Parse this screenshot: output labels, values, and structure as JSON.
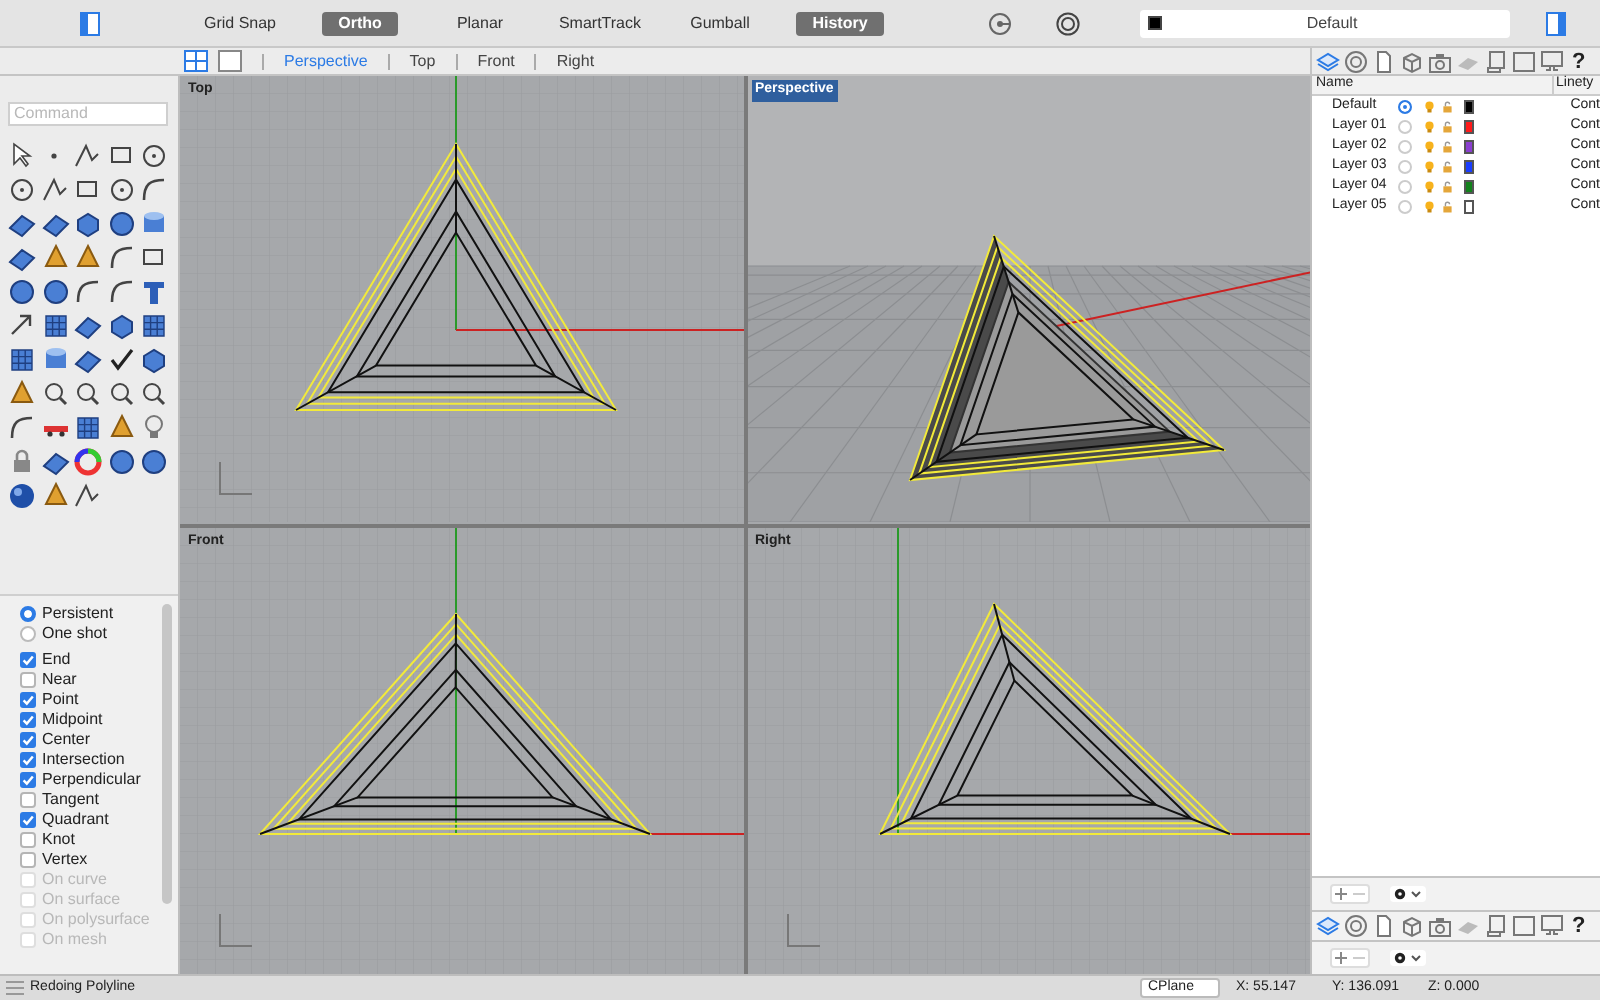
{
  "toolbar": {
    "toggles": [
      {
        "label": "Grid Snap",
        "on": false
      },
      {
        "label": "Ortho",
        "on": true
      },
      {
        "label": "Planar",
        "on": false
      },
      {
        "label": "SmartTrack",
        "on": false
      },
      {
        "label": "Gumball",
        "on": false
      },
      {
        "label": "History",
        "on": true
      }
    ],
    "layer_dropdown": {
      "value": "Default",
      "color": "#000000"
    }
  },
  "command": {
    "placeholder": "Command"
  },
  "view_tabs": [
    {
      "label": "Perspective",
      "selected": true
    },
    {
      "label": "Top",
      "selected": false
    },
    {
      "label": "Front",
      "selected": false
    },
    {
      "label": "Right",
      "selected": false
    }
  ],
  "viewports": [
    {
      "title": "Top",
      "kind": "top",
      "active": false
    },
    {
      "title": "Perspective",
      "kind": "perspective",
      "active": true
    },
    {
      "title": "Front",
      "kind": "front",
      "active": false
    },
    {
      "title": "Right",
      "kind": "right",
      "active": false
    }
  ],
  "osnap": {
    "modes": [
      {
        "label": "Persistent",
        "selected": true
      },
      {
        "label": "One shot",
        "selected": false
      }
    ],
    "snaps": [
      {
        "label": "End",
        "checked": true,
        "disabled": false
      },
      {
        "label": "Near",
        "checked": false,
        "disabled": false
      },
      {
        "label": "Point",
        "checked": true,
        "disabled": false
      },
      {
        "label": "Midpoint",
        "checked": true,
        "disabled": false
      },
      {
        "label": "Center",
        "checked": true,
        "disabled": false
      },
      {
        "label": "Intersection",
        "checked": true,
        "disabled": false
      },
      {
        "label": "Perpendicular",
        "checked": true,
        "disabled": false
      },
      {
        "label": "Tangent",
        "checked": false,
        "disabled": false
      },
      {
        "label": "Quadrant",
        "checked": true,
        "disabled": false
      },
      {
        "label": "Knot",
        "checked": false,
        "disabled": false
      },
      {
        "label": "Vertex",
        "checked": false,
        "disabled": false
      },
      {
        "label": "On curve",
        "checked": false,
        "disabled": true
      },
      {
        "label": "On surface",
        "checked": false,
        "disabled": true
      },
      {
        "label": "On polysurface",
        "checked": false,
        "disabled": true
      },
      {
        "label": "On mesh",
        "checked": false,
        "disabled": true
      }
    ]
  },
  "panel_tabs": {
    "help": "?"
  },
  "layers": {
    "columns": [
      "Name",
      "Linety"
    ],
    "rows": [
      {
        "name": "Default",
        "current": true,
        "color": "#000000",
        "linetype": "Cont"
      },
      {
        "name": "Layer 01",
        "current": false,
        "color": "#ff1a1a",
        "linetype": "Cont"
      },
      {
        "name": "Layer 02",
        "current": false,
        "color": "#8a3fd0",
        "linetype": "Cont"
      },
      {
        "name": "Layer 03",
        "current": false,
        "color": "#1a3dff",
        "linetype": "Cont"
      },
      {
        "name": "Layer 04",
        "current": false,
        "color": "#13821c",
        "linetype": "Cont"
      },
      {
        "name": "Layer 05",
        "current": false,
        "color": "#ffffff",
        "linetype": "Cont"
      }
    ]
  },
  "lower_panel_tabs": {
    "help": "?"
  },
  "status_bar": {
    "message": "Redoing Polyline",
    "cplane": "CPlane",
    "x": "X: 55.147",
    "y": "Y: 136.091",
    "z": "Z: 0.000"
  }
}
